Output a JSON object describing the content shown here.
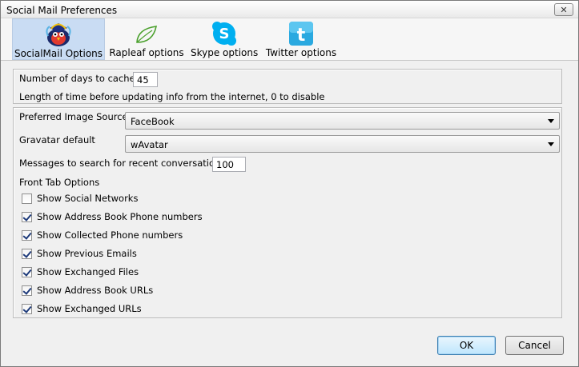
{
  "window": {
    "title": "Social Mail Preferences",
    "close_label": "✕"
  },
  "toolbar": {
    "tabs": [
      {
        "label": "SocialMail Options",
        "icon": "socialmail-icon",
        "active": true
      },
      {
        "label": "Rapleaf options",
        "icon": "rapleaf-leaf-icon",
        "active": false
      },
      {
        "label": "Skype options",
        "icon": "skype-icon",
        "active": false
      },
      {
        "label": "Twitter options",
        "icon": "twitter-icon",
        "active": false
      }
    ]
  },
  "cache": {
    "days_label": "Number of days to cache",
    "days_value": "45",
    "description": "Length of time before updating info from the internet, 0 to disable"
  },
  "options": {
    "image_source_label": "Preferred Image Source",
    "image_source_value": "FaceBook",
    "gravatar_label": "Gravatar default",
    "gravatar_value": "wAvatar",
    "messages_label": "Messages to search for recent conversations",
    "messages_value": "100",
    "front_tab_heading": "Front Tab Options",
    "checkboxes": [
      {
        "label": "Show Social Networks",
        "checked": false
      },
      {
        "label": "Show Address Book Phone numbers",
        "checked": true
      },
      {
        "label": "Show Collected Phone numbers",
        "checked": true
      },
      {
        "label": "Show Previous Emails",
        "checked": true
      },
      {
        "label": "Show Exchanged Files",
        "checked": true
      },
      {
        "label": "Show Address Book URLs",
        "checked": true
      },
      {
        "label": "Show Exchanged URLs",
        "checked": true
      }
    ]
  },
  "buttons": {
    "ok": "OK",
    "cancel": "Cancel"
  },
  "colors": {
    "active_tab": "#c9dcf3",
    "skype": "#00aff0",
    "twitter": "#2aa9e0",
    "rapleaf": "#4aa02c"
  }
}
